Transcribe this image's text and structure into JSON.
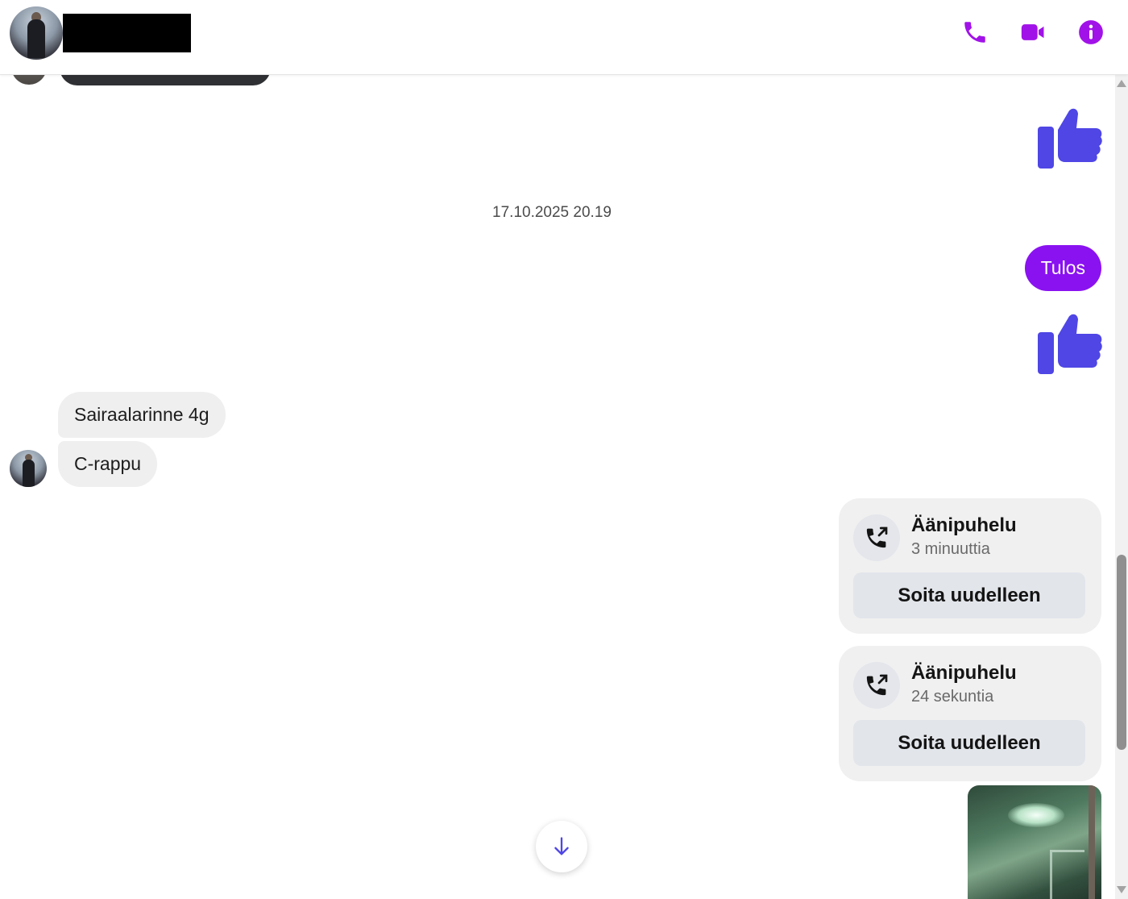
{
  "header": {
    "contact_name_redacted": true,
    "actions": [
      {
        "name": "phone-icon",
        "label": "Voice call"
      },
      {
        "name": "video-icon",
        "label": "Video call"
      },
      {
        "name": "info-icon",
        "label": "Conversation info"
      }
    ],
    "accent_color": "#a112e8"
  },
  "messages": {
    "timestamp": "17.10.2025 20.19",
    "outgoing_text": "Tulos",
    "incoming": [
      "Sairaalarinne 4g",
      "C-rappu"
    ],
    "like_color": "#4f46e5",
    "outgoing_bubble_color": "#8a12f0"
  },
  "calls": [
    {
      "title": "Äänipuhelu",
      "duration": "3 minuuttia",
      "button": "Soita uudelleen"
    },
    {
      "title": "Äänipuhelu",
      "duration": "24 sekuntia",
      "button": "Soita uudelleen"
    }
  ]
}
